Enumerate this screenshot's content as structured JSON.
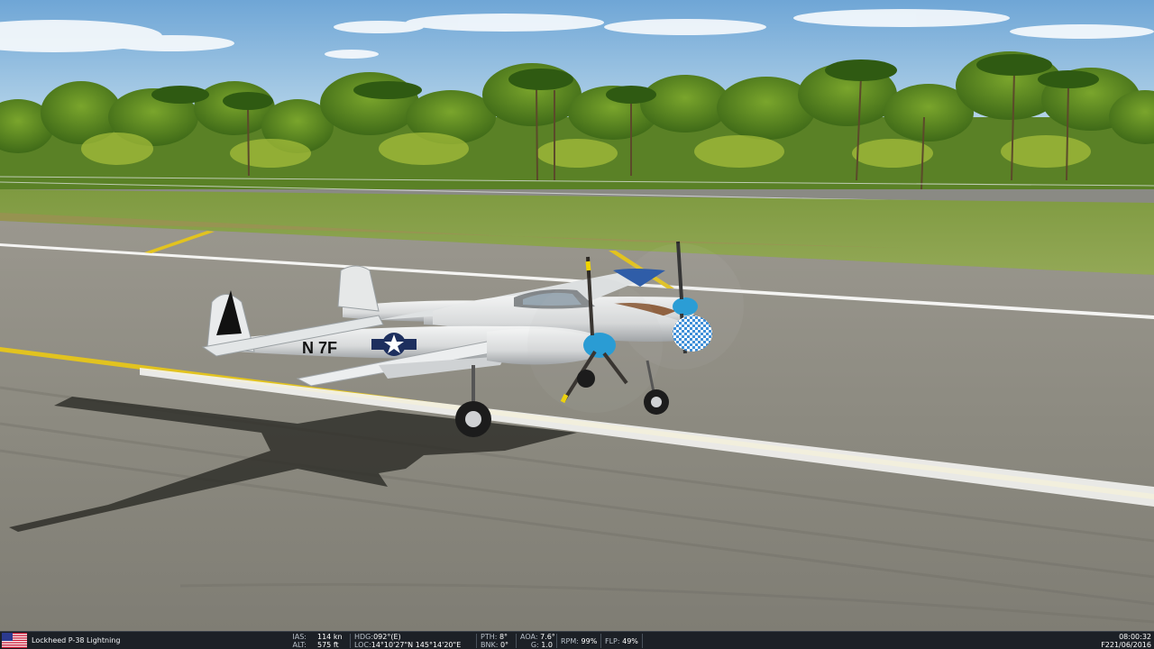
{
  "aircraft": {
    "name": "Lockheed P-38 Lightning",
    "flag_icon": "usa-flag-icon",
    "markings": "N 7F"
  },
  "hud": {
    "ias_label": "IAS:",
    "ias_value": "114 kn",
    "alt_label": "ALT:",
    "alt_value": "575 ft",
    "hdg_label": "HDG:",
    "hdg_value": "092°(E)",
    "loc_label": "LOC:",
    "loc_value": "14°10'27\"N 145°14'20\"E",
    "pth_label": "PTH:",
    "pth_value": "8°",
    "bnk_label": "BNK:",
    "bnk_value": "0°",
    "aoa_label": "AOA:",
    "aoa_value": "7.6°",
    "g_label": "G:",
    "g_value": "1.0",
    "rpm_label": "RPM:",
    "rpm_value": "99%",
    "flp_label": "FLP:",
    "flp_value": "49%",
    "time": "08:00:32",
    "date": "F221/06/2016"
  },
  "colors": {
    "sky": "#7fb2dc",
    "grass": "#7f9a43",
    "runway": "#8b8a82",
    "centerline": "#e2c31f",
    "hud_bg": "#1c2026",
    "spinner": "#1e9ad6"
  }
}
